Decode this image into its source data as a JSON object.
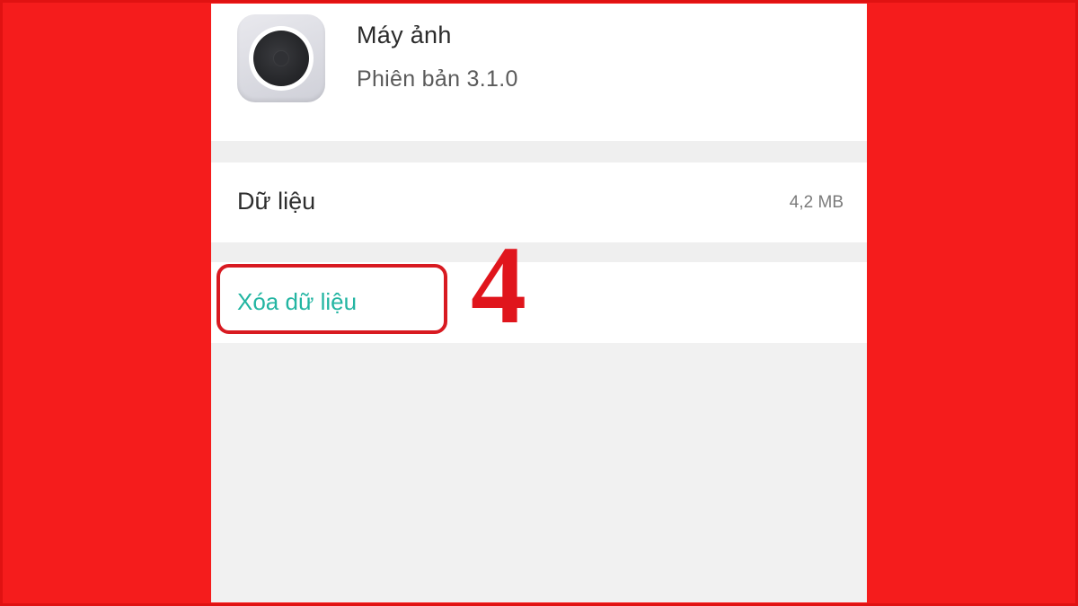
{
  "app": {
    "name": "Máy ảnh",
    "version": "Phiên bản  3.1.0",
    "icon": "camera-icon"
  },
  "storage": {
    "label": "Dữ liệu",
    "value": "4,2 MB"
  },
  "actions": {
    "clear_data_label": "Xóa dữ liệu"
  },
  "annotation": {
    "step": "4"
  },
  "colors": {
    "background": "#f51c1c",
    "accent": "#23b5a2",
    "highlight": "#d81a21"
  }
}
